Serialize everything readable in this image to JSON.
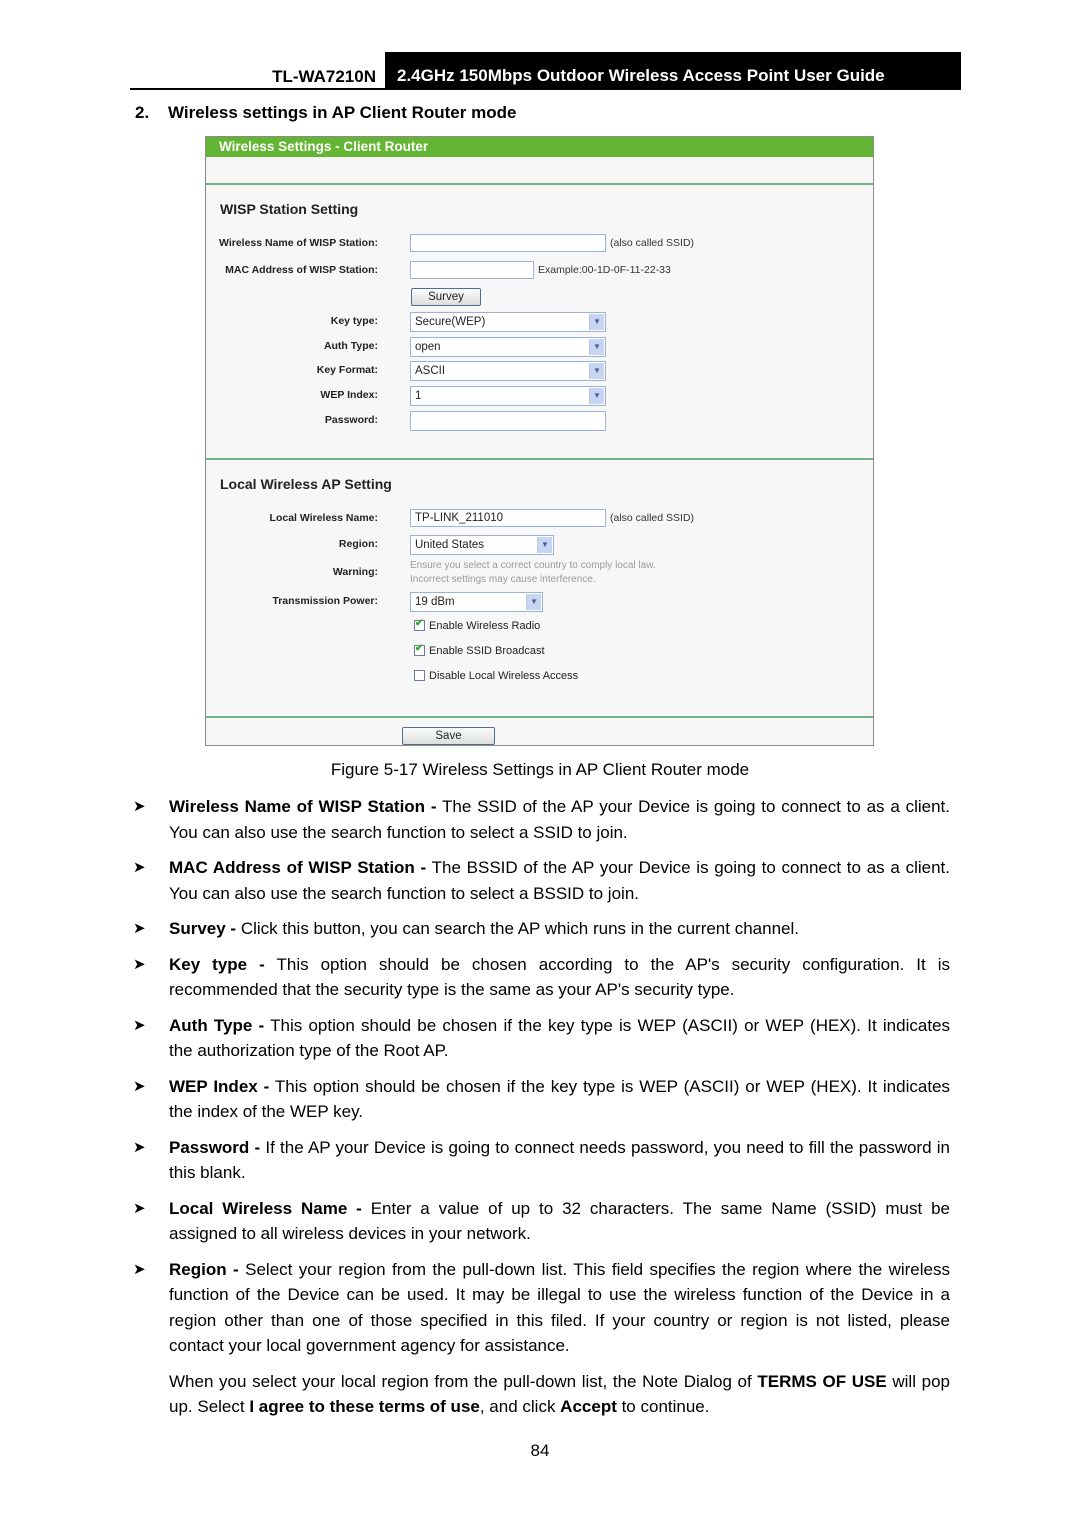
{
  "header": {
    "model": "TL-WA7210N",
    "guide_title": "2.4GHz 150Mbps Outdoor Wireless Access Point User Guide"
  },
  "section": {
    "number": "2.",
    "title": "Wireless settings in AP Client Router mode"
  },
  "panel": {
    "title": "Wireless Settings - Client Router",
    "wisp": {
      "heading": "WISP Station Setting",
      "wireless_name_label": "Wireless Name of WISP Station:",
      "wireless_name_value": "",
      "wireless_name_note": "(also called SSID)",
      "mac_label": "MAC Address of WISP Station:",
      "mac_value": "",
      "mac_note": "Example:00-1D-0F-11-22-33",
      "survey_button": "Survey",
      "key_type_label": "Key type:",
      "key_type_value": "Secure(WEP)",
      "auth_type_label": "Auth Type:",
      "auth_type_value": "open",
      "key_format_label": "Key Format:",
      "key_format_value": "ASCII",
      "wep_index_label": "WEP Index:",
      "wep_index_value": "1",
      "password_label": "Password:",
      "password_value": ""
    },
    "local": {
      "heading": "Local Wireless AP Setting",
      "name_label": "Local Wireless Name:",
      "name_value": "TP-LINK_211010",
      "name_note": "(also called SSID)",
      "region_label": "Region:",
      "region_value": "United States",
      "warning_label": "Warning:",
      "warning_line1": "Ensure you select a correct country to comply local law.",
      "warning_line2": "Incorrect settings may cause interference.",
      "power_label": "Transmission Power:",
      "power_value": "19 dBm",
      "checkboxes": [
        {
          "label": "Enable Wireless Radio",
          "checked": true
        },
        {
          "label": "Enable SSID Broadcast",
          "checked": true
        },
        {
          "label": "Disable Local Wireless Access",
          "checked": false
        }
      ]
    },
    "save_button": "Save"
  },
  "caption": "Figure 5-17 Wireless Settings in AP Client Router mode",
  "bullets": [
    {
      "term": "Wireless Name of WISP Station -",
      "text": " The SSID of the AP your Device is going to connect to as a client. You can also use the search function to select a SSID to join."
    },
    {
      "term": "MAC Address of WISP Station -",
      "text": " The BSSID of the AP your Device is going to connect to as a client. You can also use the search function to select a BSSID to join."
    },
    {
      "term": "Survey -",
      "text": " Click this button, you can search the AP which runs in the current channel."
    },
    {
      "term": "Key type -",
      "text": " This option should be chosen according to the AP's security configuration. It is recommended that the security type is the same as your AP's security type."
    },
    {
      "term": "Auth Type -",
      "text": " This option should be chosen if the key type is WEP (ASCII) or WEP (HEX). It indicates the authorization type of the Root AP."
    },
    {
      "term": "WEP Index -",
      "text": " This option should be chosen if the key type is WEP (ASCII) or WEP (HEX). It indicates the index of the WEP key."
    },
    {
      "term": "Password -",
      "text": " If the AP your Device is going to connect needs password, you need to fill the password in this blank."
    },
    {
      "term": "Local Wireless Name -",
      "text": " Enter a value of up to 32 characters. The same Name (SSID) must be assigned to all wireless devices in your network."
    },
    {
      "term": "Region -",
      "text": " Select your region from the pull-down list. This field specifies the region where the wireless function of the Device can be used. It may be illegal to use the wireless function of the Device in a region other than one of those specified in this filed. If your country or region is not listed, please contact your local government agency for assistance."
    }
  ],
  "region_note": {
    "t1": "When you select your local region from the pull-down list, the Note Dialog of ",
    "b1": "TERMS OF USE",
    "t2": " will pop up. Select ",
    "b2": "I agree to these terms of use",
    "t3": ", and click ",
    "b3": "Accept",
    "t4": " to continue."
  },
  "page_number": "84",
  "colors": {
    "panel_header": "#64b533",
    "section_rule": "#6fb48a",
    "header_bar": "#000000"
  }
}
